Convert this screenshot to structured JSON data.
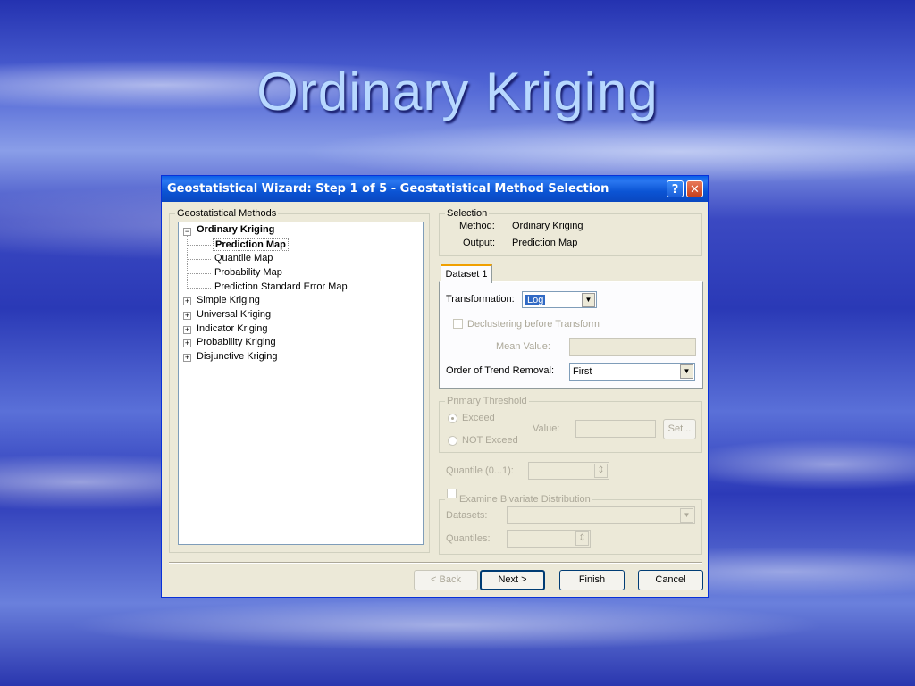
{
  "slide": {
    "title": "Ordinary Kriging"
  },
  "dialog": {
    "title": "Geostatistical Wizard: Step 1 of 5 - Geostatistical Method Selection",
    "help_symbol": "?",
    "close_symbol": "✕",
    "methods_group": "Geostatistical Methods",
    "tree": {
      "root": "Ordinary Kriging",
      "children": [
        "Prediction Map",
        "Quantile Map",
        "Probability Map",
        "Prediction Standard Error Map"
      ],
      "others": [
        "Simple Kriging",
        "Universal Kriging",
        "Indicator Kriging",
        "Probability Kriging",
        "Disjunctive Kriging"
      ],
      "expand_open": "−",
      "expand_closed": "+"
    },
    "selection": {
      "legend": "Selection",
      "method_label": "Method:",
      "method_value": "Ordinary Kriging",
      "output_label": "Output:",
      "output_value": "Prediction Map"
    },
    "dataset": {
      "tab": "Dataset 1",
      "transformation_label": "Transformation:",
      "transformation_value": "Log",
      "declustering_label": "Declustering before Transform",
      "mean_value_label": "Mean Value:",
      "mean_value": "",
      "trend_label": "Order of Trend Removal:",
      "trend_value": "First"
    },
    "threshold": {
      "legend": "Primary Threshold",
      "exceed": "Exceed",
      "not_exceed": "NOT Exceed",
      "value_label": "Value:",
      "value": "",
      "set_button": "Set..."
    },
    "quantile_label": "Quantile (0...1):",
    "bivariate": {
      "legend": "Examine Bivariate Distribution",
      "datasets_label": "Datasets:",
      "quantiles_label": "Quantiles:"
    },
    "buttons": {
      "back": "< Back",
      "next": "Next >",
      "finish": "Finish",
      "cancel": "Cancel"
    },
    "arrow_down": "▼",
    "spin": "⇕"
  }
}
